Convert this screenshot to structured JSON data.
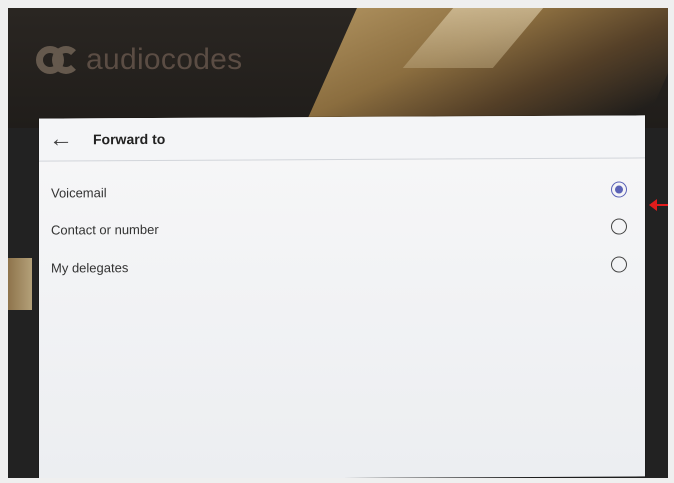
{
  "app": {
    "brand": "audiocodes"
  },
  "header": {
    "title": "Forward to",
    "back_label": "←"
  },
  "options": [
    {
      "label": "Voicemail",
      "selected": true
    },
    {
      "label": "Contact or number",
      "selected": false
    },
    {
      "label": "My delegates",
      "selected": false
    }
  ],
  "icons": {
    "back": "back-arrow-icon",
    "radio_selected": "radio-selected-icon",
    "radio_unselected": "radio-unselected-icon",
    "logo": "audiocodes-logo-icon"
  },
  "colors": {
    "accent": "#5b62b6",
    "arrow": "#e11c1c",
    "frame": "#222222"
  }
}
